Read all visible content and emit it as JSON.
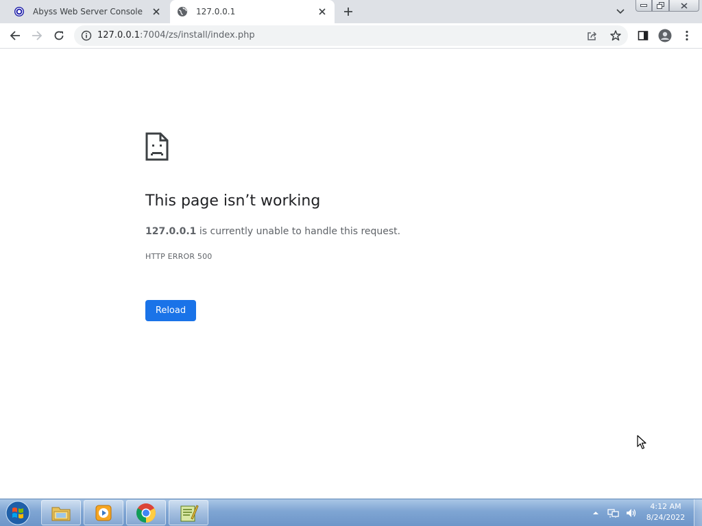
{
  "browser": {
    "tabs": [
      {
        "title": "Abyss Web Server Console",
        "favicon": "abyss-icon",
        "active": false
      },
      {
        "title": "127.0.0.1",
        "favicon": "globe-icon",
        "active": true
      }
    ],
    "address": {
      "host": "127.0.0.1",
      "path": ":7004/zs/install/index.php"
    }
  },
  "error_page": {
    "title": "This page isn’t working",
    "host": "127.0.0.1",
    "message": "is currently unable to handle this request.",
    "code": "HTTP ERROR 500",
    "reload_label": "Reload"
  },
  "taskbar": {
    "pinned": [
      "file-explorer-icon",
      "media-player-icon",
      "chrome-icon",
      "notepad-plus-plus-icon"
    ],
    "clock": {
      "time": "4:12 AM",
      "date": "8/24/2022"
    }
  },
  "colors": {
    "accent": "#1a73e8",
    "tabstrip": "#dee1e6",
    "taskbar": "#7fa5d3"
  }
}
